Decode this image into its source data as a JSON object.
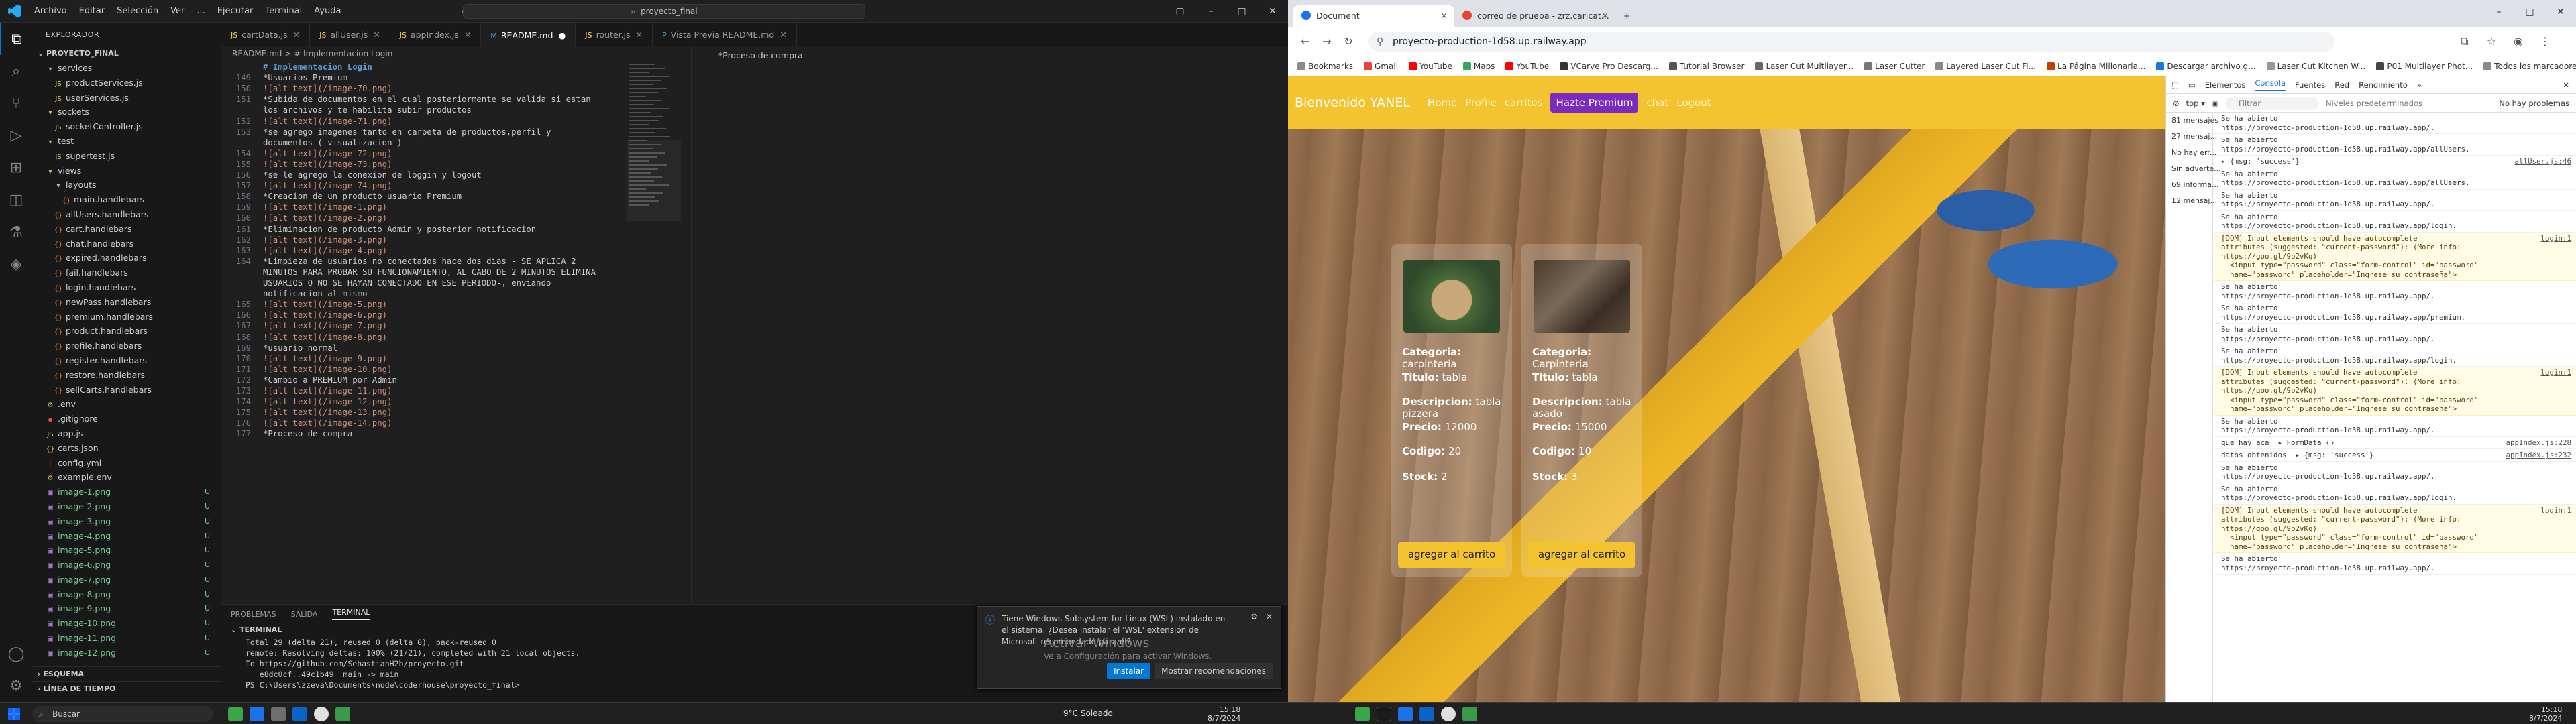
{
  "vscode": {
    "menu": [
      "Archivo",
      "Editar",
      "Selección",
      "Ver",
      "...",
      "Ejecutar",
      "Terminal",
      "Ayuda"
    ],
    "search_box": "proyecto_final",
    "sidebar": {
      "header": "EXPLORADOR",
      "project": "PROYECTO_FINAL",
      "tree": [
        {
          "label": "services",
          "indent": 1,
          "kind": "folder-open"
        },
        {
          "label": "productServices.js",
          "indent": 2,
          "kind": "js"
        },
        {
          "label": "userServices.js",
          "indent": 2,
          "kind": "js"
        },
        {
          "label": "sockets",
          "indent": 1,
          "kind": "folder-open"
        },
        {
          "label": "socketController.js",
          "indent": 2,
          "kind": "js"
        },
        {
          "label": "test",
          "indent": 1,
          "kind": "folder-open"
        },
        {
          "label": "supertest.js",
          "indent": 2,
          "kind": "js"
        },
        {
          "label": "views",
          "indent": 1,
          "kind": "folder-open"
        },
        {
          "label": "layouts",
          "indent": 2,
          "kind": "folder-open"
        },
        {
          "label": "main.handlebars",
          "indent": 3,
          "kind": "hb"
        },
        {
          "label": "allUsers.handlebars",
          "indent": 2,
          "kind": "hb"
        },
        {
          "label": "cart.handlebars",
          "indent": 2,
          "kind": "hb"
        },
        {
          "label": "chat.handlebars",
          "indent": 2,
          "kind": "hb"
        },
        {
          "label": "expired.handlebars",
          "indent": 2,
          "kind": "hb"
        },
        {
          "label": "fail.handlebars",
          "indent": 2,
          "kind": "hb"
        },
        {
          "label": "login.handlebars",
          "indent": 2,
          "kind": "hb"
        },
        {
          "label": "newPass.handlebars",
          "indent": 2,
          "kind": "hb"
        },
        {
          "label": "premium.handlebars",
          "indent": 2,
          "kind": "hb"
        },
        {
          "label": "product.handlebars",
          "indent": 2,
          "kind": "hb"
        },
        {
          "label": "profile.handlebars",
          "indent": 2,
          "kind": "hb"
        },
        {
          "label": "register.handlebars",
          "indent": 2,
          "kind": "hb"
        },
        {
          "label": "restore.handlebars",
          "indent": 2,
          "kind": "hb"
        },
        {
          "label": "sellCarts.handlebars",
          "indent": 2,
          "kind": "hb"
        },
        {
          "label": ".env",
          "indent": 1,
          "kind": "env"
        },
        {
          "label": ".gitignore",
          "indent": 1,
          "kind": "git"
        },
        {
          "label": "app.js",
          "indent": 1,
          "kind": "js"
        },
        {
          "label": "carts.json",
          "indent": 1,
          "kind": "json"
        },
        {
          "label": "config.yml",
          "indent": 1,
          "kind": "yml"
        },
        {
          "label": "example.env",
          "indent": 1,
          "kind": "env"
        },
        {
          "label": "image-1.png",
          "indent": 1,
          "kind": "png",
          "badge": "U"
        },
        {
          "label": "image-2.png",
          "indent": 1,
          "kind": "png",
          "badge": "U"
        },
        {
          "label": "image-3.png",
          "indent": 1,
          "kind": "png",
          "badge": "U"
        },
        {
          "label": "image-4.png",
          "indent": 1,
          "kind": "png",
          "badge": "U"
        },
        {
          "label": "image-5.png",
          "indent": 1,
          "kind": "png",
          "badge": "U"
        },
        {
          "label": "image-6.png",
          "indent": 1,
          "kind": "png",
          "badge": "U"
        },
        {
          "label": "image-7.png",
          "indent": 1,
          "kind": "png",
          "badge": "U"
        },
        {
          "label": "image-8.png",
          "indent": 1,
          "kind": "png",
          "badge": "U"
        },
        {
          "label": "image-9.png",
          "indent": 1,
          "kind": "png",
          "badge": "U"
        },
        {
          "label": "image-10.png",
          "indent": 1,
          "kind": "png",
          "badge": "U"
        },
        {
          "label": "image-11.png",
          "indent": 1,
          "kind": "png",
          "badge": "U"
        },
        {
          "label": "image-12.png",
          "indent": 1,
          "kind": "png",
          "badge": "U"
        }
      ],
      "outline": "ESQUEMA",
      "timeline": "LÍNEA DE TIEMPO"
    },
    "tabs": [
      {
        "label": "cartData.js",
        "icon": "JS",
        "active": false
      },
      {
        "label": "allUser.js",
        "icon": "JS",
        "active": false
      },
      {
        "label": "appIndex.js",
        "icon": "JS",
        "active": false
      },
      {
        "label": "README.md",
        "icon": "M",
        "active": true,
        "dirty": true
      },
      {
        "label": "router.js",
        "icon": "JS",
        "active": false
      },
      {
        "label": "Vista Previa README.md",
        "icon": "P",
        "active": false
      }
    ],
    "breadcrumb": "README.md > # Implementacion Login",
    "code_lines": [
      {
        "n": "",
        "t": "# Implementacion Login",
        "k": "h1"
      },
      {
        "n": "149",
        "t": "*Usuarios Premium",
        "k": "lb"
      },
      {
        "n": "150",
        "t": "![alt text](/image-70.png)",
        "k": "lk"
      },
      {
        "n": "151",
        "t": "*Subida de documentos en el cual posteriormente se valida si estan",
        "k": "lb"
      },
      {
        "n": "",
        "t": "los archivos y te habilita subir productos",
        "k": "lb"
      },
      {
        "n": "152",
        "t": "![alt text](/image-71.png)",
        "k": "lk"
      },
      {
        "n": "153",
        "t": "*se agrego imagenes tanto en carpeta de productos,perfil y",
        "k": "lb"
      },
      {
        "n": "",
        "t": "documentos ( visualizacion )",
        "k": "lb"
      },
      {
        "n": "154",
        "t": "![alt text](/image-72.png)",
        "k": "lk"
      },
      {
        "n": "155",
        "t": "![alt text](/image-73.png)",
        "k": "lk"
      },
      {
        "n": "156",
        "t": "*se le agrego la conexion de loggin y logout",
        "k": "lb"
      },
      {
        "n": "157",
        "t": "![alt text](/image-74.png)",
        "k": "lk"
      },
      {
        "n": "158",
        "t": "*Creacion de un producto usuario Premium",
        "k": "lb"
      },
      {
        "n": "159",
        "t": "![alt text](/image-1.png)",
        "k": "lk"
      },
      {
        "n": "160",
        "t": "![alt text](/image-2.png)",
        "k": "lk"
      },
      {
        "n": "161",
        "t": "*Eliminacion de producto Admin y posterior notificacion",
        "k": "lb"
      },
      {
        "n": "162",
        "t": "![alt text](/image-3.png)",
        "k": "lk"
      },
      {
        "n": "163",
        "t": "![alt text](/image-4.png)",
        "k": "lk"
      },
      {
        "n": "164",
        "t": "*Limpieza de usuarios no conectados hace dos dias - SE APLICA 2",
        "k": "lb"
      },
      {
        "n": "",
        "t": "MINUTOS PARA PROBAR SU FUNCIONAMIENTO, AL CABO DE 2 MINUTOS ELIMINA",
        "k": "lb"
      },
      {
        "n": "",
        "t": "USUARIOS Q NO SE HAYAN CONECTADO EN ESE PERIODO-, enviando",
        "k": "lb"
      },
      {
        "n": "",
        "t": "notificacion al mismo",
        "k": "lb"
      },
      {
        "n": "165",
        "t": "![alt text](/image-5.png)",
        "k": "lk"
      },
      {
        "n": "166",
        "t": "![alt text](/image-6.png)",
        "k": "lk"
      },
      {
        "n": "167",
        "t": "![alt text](/image-7.png)",
        "k": "lk"
      },
      {
        "n": "168",
        "t": "![alt text](/image-8.png)",
        "k": "lk"
      },
      {
        "n": "169",
        "t": "*usuario normal",
        "k": "lb"
      },
      {
        "n": "170",
        "t": "![alt text](/image-9.png)",
        "k": "lk"
      },
      {
        "n": "171",
        "t": "![alt text](/image-10.png)",
        "k": "lk"
      },
      {
        "n": "172",
        "t": "*Cambio a PREMIUM por Admin",
        "k": "lb"
      },
      {
        "n": "173",
        "t": "![alt text](/image-11.png)",
        "k": "lk"
      },
      {
        "n": "174",
        "t": "![alt text](/image-12.png)",
        "k": "lk"
      },
      {
        "n": "175",
        "t": "![alt text](/image-13.png)",
        "k": "lk"
      },
      {
        "n": "176",
        "t": "![alt text](/image-14.png)",
        "k": "lk"
      },
      {
        "n": "177",
        "t": "*Proceso de compra",
        "k": "lb"
      }
    ],
    "preview_text": "*Proceso de compra",
    "panel": {
      "tabs": [
        "PROBLEMAS",
        "SALIDA",
        "TERMINAL"
      ],
      "terminal_header": "TERMINAL",
      "terminal_lines": [
        "Total 29 (delta 21), reused 0 (delta 0), pack-reused 0",
        "remote: Resolving deltas: 100% (21/21), completed with 21 local objects.",
        "To https://github.com/SebastianH2b/proyecto.git",
        "   e8dc0cf..49c1b49  main -> main",
        "PS C:\\Users\\zzeva\\Documents\\node\\coderhouse\\proyecto_final> "
      ]
    },
    "notification": {
      "text": "Tiene Windows Subsystem for Linux (WSL) instalado en el sistema. ¿Desea instalar el 'WSL' extensión de Microsoft recomendado para él?",
      "install": "Instalar",
      "show": "Mostrar recomendaciones"
    },
    "watermark_title": "Activar Windows",
    "watermark_sub": "Ve a Configuración para activar Windows."
  },
  "chrome": {
    "tabs": [
      {
        "label": "Document",
        "active": true,
        "color": "#1a73e8"
      },
      {
        "label": "correo de prueba - zrz.caricat...",
        "active": false,
        "color": "#ea4335"
      }
    ],
    "url": "proyecto-production-1d58.up.railway.app",
    "bookmarks": [
      "Bookmarks",
      "Gmail",
      "YouTube",
      "Maps",
      "YouTube",
      "VCarve Pro Descarg...",
      "Tutorial Browser",
      "Laser Cut Multilayer...",
      "Laser Cutter",
      "Layered Laser Cut Fi...",
      "La Página Millonaria...",
      "Descargar archivo g...",
      "Laser Cut Kitchen W...",
      "P01 Multilayer Phot...",
      "Todos los marcadores"
    ],
    "site": {
      "brand": "Bienvenido YANEL",
      "nav": [
        "Home",
        "Profile",
        "carritos"
      ],
      "premium": "Hazte Premium",
      "nav2": [
        "chat",
        "Logout"
      ],
      "cards": [
        {
          "categoria": "carpinteria",
          "titulo": "tabla",
          "descripcion": "tabla pizzera",
          "precio": "12000",
          "codigo": "20",
          "stock": "2",
          "button": "agregar al carrito"
        },
        {
          "categoria": "Carpinteria",
          "titulo": "tabla",
          "descripcion": "tabla asado",
          "precio": "15000",
          "codigo": "10",
          "stock": "3",
          "button": "agregar al carrito"
        }
      ],
      "labels": {
        "categoria": "Categoria:",
        "titulo": "Titulo:",
        "descripcion": "Descripcion:",
        "precio": "Precio:",
        "codigo": "Codigo:",
        "stock": "Stock:"
      }
    },
    "devtools": {
      "tabs": [
        "Elementos",
        "Consola",
        "Fuentes",
        "Red",
        "Rendimiento"
      ],
      "context": "top",
      "filter": "Filtrar",
      "levels": "Niveles predeterminados",
      "issues": "No hay problemas",
      "side": [
        "81 mensajes",
        "27 mensaj...",
        "No hay err...",
        "Sin adverte...",
        "69 informa...",
        "12 mensaj..."
      ],
      "messages": [
        {
          "t": "Se ha abierto\nhttps://proyecto-production-1d58.up.railway.app/.",
          "k": "log"
        },
        {
          "t": "Se ha abierto\nhttps://proyecto-production-1d58.up.railway.app/allUsers.",
          "k": "log"
        },
        {
          "t": "▸ {msg: 'success'}",
          "k": "log",
          "src": "allUser.js:46"
        },
        {
          "t": "Se ha abierto\nhttps://proyecto-production-1d58.up.railway.app/allUsers.",
          "k": "log"
        },
        {
          "t": "Se ha abierto\nhttps://proyecto-production-1d58.up.railway.app/.",
          "k": "log"
        },
        {
          "t": "Se ha abierto\nhttps://proyecto-production-1d58.up.railway.app/login.",
          "k": "log"
        },
        {
          "t": "[DOM] Input elements should have autocomplete\nattributes (suggested: \"current-password\"): (More info:\nhttps://goo.gl/9p2vKq)\n  <input type=\"password\" class=\"form-control\" id=\"password\"\n  name=\"password\" placeholder=\"Ingrese su contraseña\">",
          "k": "warn",
          "src": "login:1"
        },
        {
          "t": "Se ha abierto\nhttps://proyecto-production-1d58.up.railway.app/.",
          "k": "log"
        },
        {
          "t": "Se ha abierto\nhttps://proyecto-production-1d58.up.railway.app/premium.",
          "k": "log"
        },
        {
          "t": "Se ha abierto\nhttps://proyecto-production-1d58.up.railway.app/.",
          "k": "log"
        },
        {
          "t": "Se ha abierto\nhttps://proyecto-production-1d58.up.railway.app/login.",
          "k": "log"
        },
        {
          "t": "[DOM] Input elements should have autocomplete\nattributes (suggested: \"current-password\"): (More info:\nhttps://goo.gl/9p2vKq)\n  <input type=\"password\" class=\"form-control\" id=\"password\"\n  name=\"password\" placeholder=\"Ingrese su contraseña\">",
          "k": "warn",
          "src": "login:1"
        },
        {
          "t": "Se ha abierto\nhttps://proyecto-production-1d58.up.railway.app/.",
          "k": "log"
        },
        {
          "t": "que hay aca  ▸ FormData {}",
          "k": "log",
          "src": "appIndex.js:228"
        },
        {
          "t": "datos obtenidos  ▸ {msg: 'success'}",
          "k": "log",
          "src": "appIndex.js:232"
        },
        {
          "t": "Se ha abierto\nhttps://proyecto-production-1d58.up.railway.app/.",
          "k": "log"
        },
        {
          "t": "Se ha abierto\nhttps://proyecto-production-1d58.up.railway.app/login.",
          "k": "log"
        },
        {
          "t": "[DOM] Input elements should have autocomplete\nattributes (suggested: \"current-password\"): (More info:\nhttps://goo.gl/9p2vKq)\n  <input type=\"password\" class=\"form-control\" id=\"password\"\n  name=\"password\" placeholder=\"Ingrese su contraseña\">",
          "k": "warn",
          "src": "login:1"
        },
        {
          "t": "Se ha abierto\nhttps://proyecto-production-1d58.up.railway.app/.",
          "k": "log"
        }
      ]
    }
  },
  "taskbar": {
    "search": "Buscar",
    "weather": "9°C  Soleado",
    "time_left": "15:18",
    "date_left": "8/7/2024",
    "time_right": "15:18",
    "date_right": "8/7/2024"
  }
}
